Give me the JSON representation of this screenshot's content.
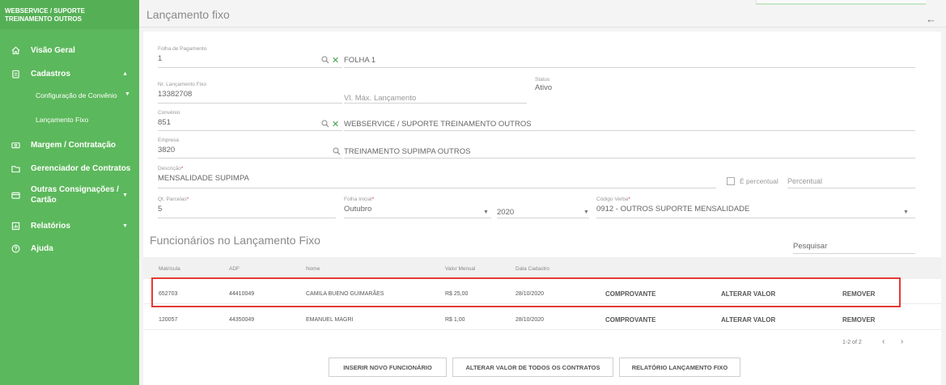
{
  "sidebar": {
    "brand_line1": "WEBSERVICE / SUPORTE",
    "brand_line2": "TREINAMENTO OUTROS",
    "items": [
      {
        "label": "Visão Geral",
        "icon": "home-icon"
      },
      {
        "label": "Cadastros",
        "icon": "clipboard-icon"
      },
      {
        "label": "Configuração de Convênio"
      },
      {
        "label": "Lançamento Fixo"
      },
      {
        "label": "Margem / Contratação",
        "icon": "money-icon"
      },
      {
        "label": "Gerenciador de Contratos",
        "icon": "folder-icon"
      },
      {
        "label": "Outras Consignações /",
        "label2": "Cartão",
        "icon": "card-icon"
      },
      {
        "label": "Relatórios",
        "icon": "chart-icon"
      },
      {
        "label": "Ajuda",
        "icon": "help-icon"
      }
    ]
  },
  "header": {
    "title": "Lançamento fixo",
    "back_icon": "arrow-left-icon"
  },
  "form": {
    "folha": {
      "label": "Folha de Pagamento",
      "value": "1",
      "desc": "FOLHA 1"
    },
    "nr_lancamento": {
      "label": "Nr. Lançamento Fixo",
      "value": "13382708"
    },
    "vl_max": {
      "placeholder": "Vl. Máx. Lançamento"
    },
    "status": {
      "label": "Status",
      "value": "Ativo"
    },
    "convenio": {
      "label": "Convênio",
      "value": "851",
      "desc": "WEBSERVICE / SUPORTE TREINAMENTO OUTROS"
    },
    "empresa": {
      "label": "Empresa",
      "value": "3820",
      "desc": "TREINAMENTO SUPIMPA OUTROS"
    },
    "descricao": {
      "label": "Descrição",
      "value": "MENSALIDADE SUPIMPA"
    },
    "percentual": {
      "checkbox_label": "É percentual",
      "placeholder": "Percentual"
    },
    "qt_parcelas": {
      "label": "Qt. Parcelas",
      "value": "5"
    },
    "folha_inicial": {
      "label": "Folha Inicial",
      "month": "Outubro",
      "year": "2020"
    },
    "codigo_verba": {
      "label": "Código Verba",
      "value": "0912 - OUTROS SUPORTE MENSALIDADE"
    },
    "required_mark": "*"
  },
  "employees": {
    "title": "Funcionários no Lançamento Fixo",
    "search_placeholder": "Pesquisar",
    "columns": [
      "Matrícula",
      "ADF",
      "Nome",
      "Valor Mensal",
      "Data Cadastro"
    ],
    "rows": [
      {
        "matricula": "652703",
        "adf": "44410049",
        "nome": "CAMILA BUENO GUIMARÃES",
        "valor": "R$ 25,00",
        "data": "28/10/2020"
      },
      {
        "matricula": "120057",
        "adf": "44350049",
        "nome": "EMANUEL MAGRI",
        "valor": "R$ 1,00",
        "data": "28/10/2020"
      }
    ],
    "actions": {
      "comprovante": "COMPROVANTE",
      "alterar": "ALTERAR VALOR",
      "remover": "REMOVER"
    },
    "pager": "1-2 of 2"
  },
  "buttons": {
    "inserir": "INSERIR NOVO FUNCIONÁRIO",
    "alterar_todos": "ALTERAR VALOR DE TODOS OS CONTRATOS",
    "relatorio": "RELATÓRIO LANÇAMENTO FIXO"
  },
  "colors": {
    "sidebar": "#5cb85c",
    "highlight": "#e53935",
    "clear_icon": "#43a047"
  }
}
